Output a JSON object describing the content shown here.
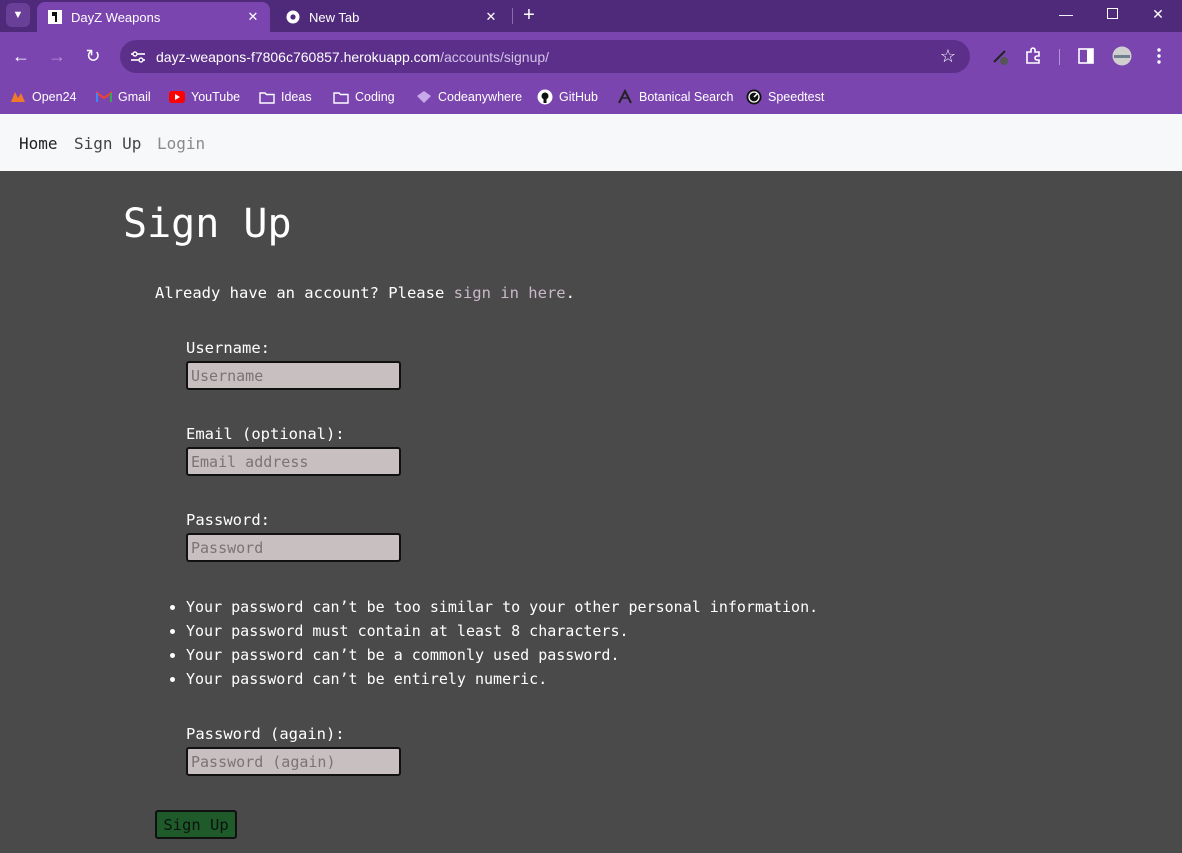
{
  "browser": {
    "tabs": [
      {
        "title": "DayZ Weapons",
        "active": true,
        "favicon": "dayz-favicon-icon"
      },
      {
        "title": "New Tab",
        "active": false,
        "favicon": "chrome-icon"
      }
    ],
    "url": {
      "host": "dayz-weapons-f7806c760857.herokuapp.com",
      "path": "/accounts/signup/"
    },
    "bookmarks": [
      {
        "label": "Open24",
        "icon": "open24-icon"
      },
      {
        "label": "Gmail",
        "icon": "gmail-icon"
      },
      {
        "label": "YouTube",
        "icon": "youtube-icon"
      },
      {
        "label": "Ideas",
        "icon": "folder-icon"
      },
      {
        "label": "Coding",
        "icon": "folder-icon"
      },
      {
        "label": "Codeanywhere",
        "icon": "codeanywhere-icon"
      },
      {
        "label": "GitHub",
        "icon": "github-icon"
      },
      {
        "label": "Botanical Search",
        "icon": "botanical-icon"
      },
      {
        "label": "Speedtest",
        "icon": "speedtest-icon"
      }
    ],
    "colors": {
      "frame": "#4f2a7a",
      "toolbar": "#7b45b0",
      "omnibox": "#5b2f8a"
    }
  },
  "nav": {
    "home": "Home",
    "signup": "Sign Up",
    "login": "Login"
  },
  "page": {
    "heading": "Sign Up",
    "intro_prefix": "Already have an account? Please ",
    "intro_link": "sign in here",
    "intro_suffix": ".",
    "fields": {
      "username": {
        "label": "Username:",
        "placeholder": "Username",
        "value": ""
      },
      "email": {
        "label": "Email (optional):",
        "placeholder": "Email address",
        "value": ""
      },
      "password": {
        "label": "Password:",
        "placeholder": "Password",
        "value": ""
      },
      "password2": {
        "label": "Password (again):",
        "placeholder": "Password (again)",
        "value": ""
      }
    },
    "password_help": [
      "Your password can’t be too similar to your other personal information.",
      "Your password must contain at least 8 characters.",
      "Your password can’t be a commonly used password.",
      "Your password can’t be entirely numeric."
    ],
    "submit_label": "Sign Up",
    "colors": {
      "background": "#4a4a4a",
      "input": "#c8bfc0",
      "button": "#1e5a2a",
      "link": "#c9b8c8"
    }
  }
}
